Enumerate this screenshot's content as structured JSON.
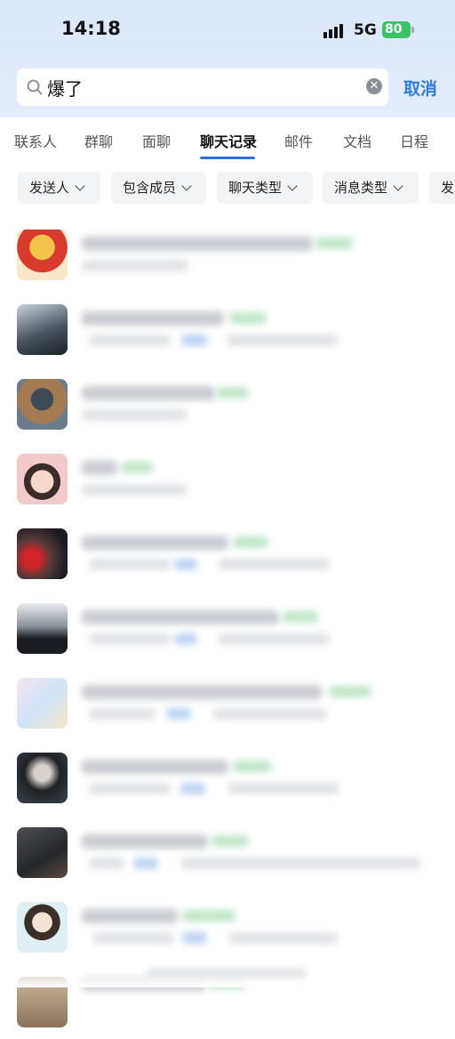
{
  "status_bar": {
    "time": "14:18",
    "network": "5G",
    "battery": "80"
  },
  "search": {
    "value": "爆了",
    "cancel_label": "取消"
  },
  "tabs": [
    {
      "label": "联系人"
    },
    {
      "label": "群聊"
    },
    {
      "label": "面聊"
    },
    {
      "label": "聊天记录"
    },
    {
      "label": "邮件"
    },
    {
      "label": "文档"
    },
    {
      "label": "日程"
    }
  ],
  "active_tab": "聊天记录",
  "filters": [
    {
      "label": "发送人"
    },
    {
      "label": "包含成员"
    },
    {
      "label": "聊天类型"
    },
    {
      "label": "消息类型"
    },
    {
      "label": "发"
    }
  ],
  "results_count_visible": 10,
  "colors": {
    "accent": "#2d7be0",
    "tab_indicator": "#2d6fdc",
    "battery": "#3dc266"
  }
}
